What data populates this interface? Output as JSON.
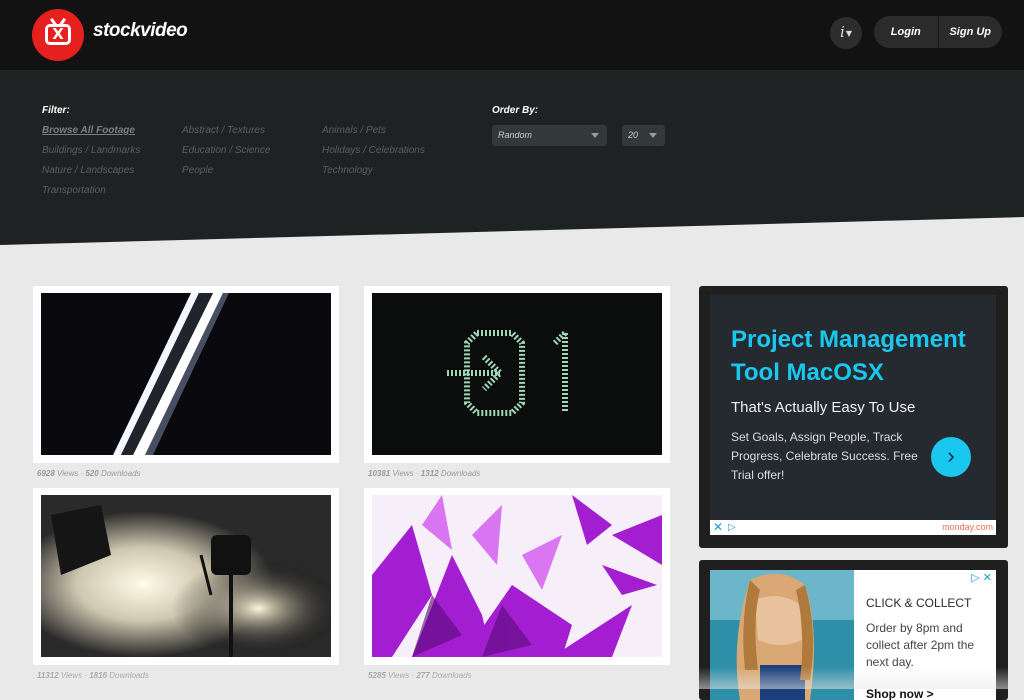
{
  "header": {
    "logo_text": "stockvideo",
    "logo_mark": "X",
    "info_label": "i",
    "login_label": "Login",
    "signup_label": "Sign Up"
  },
  "filter": {
    "heading": "Filter:",
    "categories": [
      {
        "label": "Browse All Footage",
        "active": true
      },
      {
        "label": "Abstract / Textures"
      },
      {
        "label": "Animals / Pets"
      },
      {
        "label": "Buildings / Landmarks"
      },
      {
        "label": "Education / Science"
      },
      {
        "label": "Holidays / Celebrations"
      },
      {
        "label": "Nature / Landscapes"
      },
      {
        "label": "People"
      },
      {
        "label": "Technology"
      },
      {
        "label": "Transportation"
      }
    ]
  },
  "order": {
    "heading": "Order By:",
    "sort_value": "Random",
    "count_value": "20"
  },
  "videos": [
    {
      "views": "6928",
      "downloads": "520",
      "views_label": "Views",
      "downloads_label": "Downloads"
    },
    {
      "views": "10381",
      "downloads": "1312",
      "views_label": "Views",
      "downloads_label": "Downloads"
    },
    {
      "views": "11312",
      "downloads": "1816",
      "views_label": "Views",
      "downloads_label": "Downloads"
    },
    {
      "views": "5285",
      "downloads": "277",
      "views_label": "Views",
      "downloads_label": "Downloads"
    }
  ],
  "ad1": {
    "title": "Project Management Tool MacOSX",
    "subtitle": "That's Actually Easy To Use",
    "body": "Set Goals, Assign People, Track Progress, Celebrate Success. Free Trial offer!",
    "brand": "monday.com"
  },
  "ad2": {
    "title": "CLICK & COLLECT",
    "body": "Order by 8pm and collect after 2pm the next day.",
    "cta": "Shop now >"
  },
  "colors": {
    "brand_red": "#e61f1f",
    "ad_accent": "#19c7ef",
    "header_bg": "#121212",
    "filter_bg": "#1f2222"
  }
}
